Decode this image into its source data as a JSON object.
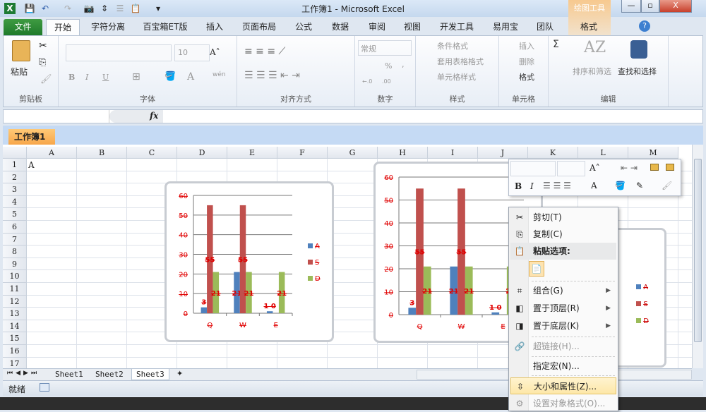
{
  "window": {
    "title": "工作簿1 - Microsoft Excel",
    "context_tab_group": "绘图工具",
    "min": "—",
    "restore": "▫",
    "close": "X"
  },
  "quick_access": [
    "X",
    "💾",
    "↶",
    "▾",
    "↷",
    "▾",
    "📷",
    "⇕",
    "☰",
    "📋",
    "▾",
    "▾"
  ],
  "tabs": [
    "文件",
    "开始",
    "字符分离",
    "百宝箱ET版",
    "插入",
    "页面布局",
    "公式",
    "数据",
    "审阅",
    "视图",
    "开发工具",
    "易用宝",
    "团队",
    "格式"
  ],
  "ribbon": {
    "clipboard": {
      "label": "剪贴板",
      "paste": "粘贴"
    },
    "font": {
      "label": "字体",
      "size": "10",
      "bold": "B",
      "italic": "I",
      "underline": "U",
      "grow": "A˄",
      "shrink": "A˅",
      "fontcolor": "A",
      "phonetic": "wén"
    },
    "align": {
      "label": "对齐方式"
    },
    "number": {
      "label": "数字",
      "format": "常规",
      "percent": "%",
      "comma": ",",
      "inc": "←.0",
      "dec": ".00"
    },
    "styles": {
      "label": "样式",
      "cond": "条件格式",
      "table": "套用表格格式",
      "cell": "单元格样式"
    },
    "cells": {
      "label": "单元格",
      "insert": "插入",
      "delete": "删除",
      "format": "格式"
    },
    "editing": {
      "label": "编辑",
      "sum": "Σ",
      "sort": "排序和筛选",
      "find": "查找和选择"
    }
  },
  "formula_bar": {
    "fx": "fx",
    "value": ""
  },
  "workbook_tab": "工作簿1",
  "columns": [
    "A",
    "B",
    "C",
    "D",
    "E",
    "F",
    "G",
    "H",
    "I",
    "J",
    "K",
    "L",
    "M"
  ],
  "rows": [
    "1",
    "2",
    "3",
    "4",
    "5",
    "6",
    "7",
    "8",
    "9",
    "10",
    "11",
    "12",
    "13",
    "14",
    "15",
    "16",
    "17"
  ],
  "cells": {
    "A1": "A"
  },
  "chart_data": [
    {
      "type": "bar",
      "categories": [
        "Q",
        "W",
        "E"
      ],
      "series": [
        {
          "name": "A",
          "values": [
            3,
            21,
            1
          ],
          "labels": [
            "3",
            "21",
            "1 0"
          ]
        },
        {
          "name": "S",
          "values": [
            55,
            55,
            0
          ],
          "labels": [
            "55",
            "55",
            ""
          ]
        },
        {
          "name": "D",
          "values": [
            21,
            21,
            21
          ],
          "labels": [
            "21",
            "21",
            "21"
          ]
        }
      ],
      "ylim": [
        0,
        60
      ],
      "yticks": [
        "0",
        "10",
        "20",
        "30",
        "40",
        "50",
        "60"
      ],
      "grid": true,
      "legend": "right",
      "colors": [
        "#4f81bd",
        "#c0504d",
        "#9bbb59"
      ],
      "label_color": "#e00000"
    },
    {
      "type": "bar",
      "categories": [
        "Q",
        "W",
        "E"
      ],
      "series": [
        {
          "name": "A",
          "values": [
            3,
            21,
            1
          ],
          "labels": [
            "3",
            "21",
            "1 0"
          ]
        },
        {
          "name": "S",
          "values": [
            55,
            55,
            0
          ],
          "labels": [
            "55",
            "55",
            ""
          ]
        },
        {
          "name": "D",
          "values": [
            21,
            21,
            21
          ],
          "labels": [
            "21",
            "21",
            "21"
          ]
        }
      ],
      "ylim": [
        0,
        60
      ],
      "yticks": [
        "0",
        "10",
        "20",
        "30",
        "40",
        "50",
        "60"
      ],
      "grid": true,
      "legend": "right",
      "colors": [
        "#4f81bd",
        "#c0504d",
        "#9bbb59"
      ],
      "label_color": "#e00000"
    }
  ],
  "third_chart_legend": [
    "A",
    "S",
    "D"
  ],
  "mini_toolbar": {
    "grow": "A˄",
    "shrink": "A˅",
    "bold": "B",
    "italic": "I",
    "fontcolor": "A"
  },
  "context_menu": [
    {
      "label": "剪切(T)",
      "icon": "✂"
    },
    {
      "label": "复制(C)",
      "icon": "⎘"
    },
    {
      "label": "粘贴选项:",
      "icon": "📋"
    },
    {
      "label": "组合(G)",
      "icon": "⌗",
      "arrow": "▶"
    },
    {
      "label": "置于顶层(R)",
      "icon": "◧",
      "arrow": "▶"
    },
    {
      "label": "置于底层(K)",
      "icon": "◨",
      "arrow": "▶"
    },
    {
      "label": "超链接(H)...",
      "icon": "🔗"
    },
    {
      "label": "指定宏(N)...",
      "icon": ""
    },
    {
      "label": "大小和属性(Z)...",
      "icon": "⇳"
    },
    {
      "label": "设置对象格式(O)...",
      "icon": "⚙"
    }
  ],
  "sheet_tabs": [
    "Sheet1",
    "Sheet2",
    "Sheet3"
  ],
  "status": {
    "ready": "就绪"
  }
}
